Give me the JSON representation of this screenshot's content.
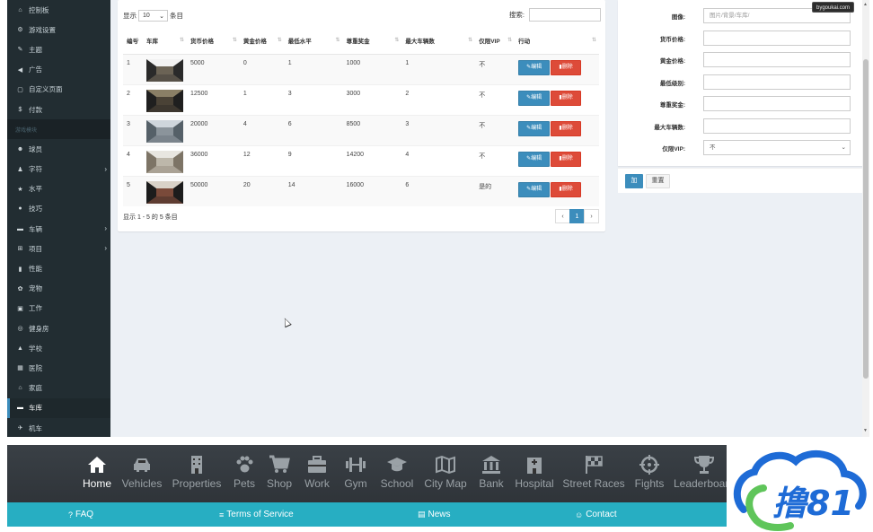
{
  "sidebar": {
    "items": [
      {
        "label": "控制板",
        "icon": "home-icon",
        "glyph": "⌂",
        "header": false,
        "arrow": false
      },
      {
        "label": "游戏设置",
        "icon": "gears-icon",
        "glyph": "⚙",
        "header": false,
        "arrow": false
      },
      {
        "label": "主题",
        "icon": "brush-icon",
        "glyph": "✎",
        "header": false,
        "arrow": false
      },
      {
        "label": "广告",
        "icon": "megaphone-icon",
        "glyph": "◀",
        "header": false,
        "arrow": false
      },
      {
        "label": "自定义页面",
        "icon": "window-icon",
        "glyph": "▢",
        "header": false,
        "arrow": false
      },
      {
        "label": "付款",
        "icon": "dollar-icon",
        "glyph": "$",
        "header": false,
        "arrow": false
      },
      {
        "label": "游戏模块",
        "icon": "",
        "glyph": "",
        "header": true,
        "arrow": false
      },
      {
        "label": "球员",
        "icon": "users-icon",
        "glyph": "☻",
        "header": false,
        "arrow": false
      },
      {
        "label": "字符",
        "icon": "person-icon",
        "glyph": "♟",
        "header": false,
        "arrow": true
      },
      {
        "label": "水平",
        "icon": "star-icon",
        "glyph": "★",
        "header": false,
        "arrow": false
      },
      {
        "label": "技巧",
        "icon": "lightbulb-icon",
        "glyph": "●",
        "header": false,
        "arrow": false
      },
      {
        "label": "车辆",
        "icon": "car-icon",
        "glyph": "▬",
        "header": false,
        "arrow": true
      },
      {
        "label": "项目",
        "icon": "cart-icon",
        "glyph": "⊞",
        "header": false,
        "arrow": true
      },
      {
        "label": "性能",
        "icon": "building-icon",
        "glyph": "▮",
        "header": false,
        "arrow": false
      },
      {
        "label": "宠物",
        "icon": "paw-icon",
        "glyph": "✿",
        "header": false,
        "arrow": false
      },
      {
        "label": "工作",
        "icon": "briefcase-icon",
        "glyph": "▣",
        "header": false,
        "arrow": false
      },
      {
        "label": "健身房",
        "icon": "target-icon",
        "glyph": "◎",
        "header": false,
        "arrow": false
      },
      {
        "label": "学校",
        "icon": "graduation-cap-icon",
        "glyph": "▲",
        "header": false,
        "arrow": false
      },
      {
        "label": "医院",
        "icon": "hospital-icon",
        "glyph": "▦",
        "header": false,
        "arrow": false
      },
      {
        "label": "家庭",
        "icon": "home-icon",
        "glyph": "⌂",
        "header": false,
        "arrow": false
      },
      {
        "label": "车库",
        "icon": "car-icon",
        "glyph": "▬",
        "header": false,
        "arrow": false,
        "active": true
      },
      {
        "label": "机车",
        "icon": "plane-icon",
        "glyph": "✈",
        "header": false,
        "arrow": false
      }
    ]
  },
  "table": {
    "length_prefix": "显示",
    "length_value": "10",
    "length_suffix": "条目",
    "search_label": "搜索:",
    "columns": [
      "编号",
      "车库",
      "货币价格",
      "黄金价格",
      "最低水平",
      "尊重奖金",
      "最大车辆数",
      "仅限VIP",
      "行动"
    ],
    "rows": [
      {
        "id": "1",
        "money": "5000",
        "gold": "0",
        "level": "1",
        "respect": "1000",
        "max": "1",
        "vip": "不",
        "thumb": "garage-1"
      },
      {
        "id": "2",
        "money": "12500",
        "gold": "1",
        "level": "3",
        "respect": "3000",
        "max": "2",
        "vip": "不",
        "thumb": "garage-2"
      },
      {
        "id": "3",
        "money": "20000",
        "gold": "4",
        "level": "6",
        "respect": "8500",
        "max": "3",
        "vip": "不",
        "thumb": "garage-3"
      },
      {
        "id": "4",
        "money": "36000",
        "gold": "12",
        "level": "9",
        "respect": "14200",
        "max": "4",
        "vip": "不",
        "thumb": "garage-4"
      },
      {
        "id": "5",
        "money": "50000",
        "gold": "20",
        "level": "14",
        "respect": "16000",
        "max": "6",
        "vip": "是的",
        "thumb": "garage-5"
      }
    ],
    "edit_label": "编辑",
    "delete_label": "删除",
    "info": "显示 1 - 5 的 5 条目",
    "pager_prev": "‹",
    "pager_page": "1",
    "pager_next": "›"
  },
  "form": {
    "fields": [
      {
        "label": "图像:",
        "placeholder": "图片/背景/车库/",
        "type": "input"
      },
      {
        "label": "货币价格:",
        "placeholder": "",
        "type": "input"
      },
      {
        "label": "黄金价格:",
        "placeholder": "",
        "type": "input"
      },
      {
        "label": "最低级别:",
        "placeholder": "",
        "type": "input"
      },
      {
        "label": "尊重奖金:",
        "placeholder": "",
        "type": "input"
      },
      {
        "label": "最大车辆数:",
        "placeholder": "",
        "type": "input"
      },
      {
        "label": "仅限VIP:",
        "placeholder": "不",
        "type": "select"
      }
    ],
    "add_label": "加",
    "reset_label": "重置"
  },
  "watermark": "bygoukai.com",
  "gamenav": {
    "items": [
      "Home",
      "Vehicles",
      "Properties",
      "Pets",
      "Shop",
      "Work",
      "Gym",
      "School",
      "City Map",
      "Bank",
      "Hospital",
      "Street Races",
      "Fights",
      "Leaderboard"
    ],
    "icons": [
      "home-icon",
      "car-icon",
      "building-icon",
      "paw-icon",
      "cart-icon",
      "briefcase-icon",
      "dumbbell-icon",
      "graduation-cap-icon",
      "map-icon",
      "bank-icon",
      "hospital-icon",
      "checkered-flag-icon",
      "crosshair-icon",
      "trophy-icon"
    ],
    "active": "Home"
  },
  "footer": {
    "items": [
      {
        "label": "FAQ",
        "icon": "question-circle-icon"
      },
      {
        "label": "Terms of Service",
        "icon": "list-icon"
      },
      {
        "label": "News",
        "icon": "newspaper-icon"
      },
      {
        "label": "Contact",
        "icon": "contact-icon"
      }
    ]
  },
  "logo": {
    "text": "撸81",
    "colors": {
      "blue": "#1e6bd6",
      "green": "#5fc55a"
    }
  },
  "colors": {
    "sidebar": "#222d32",
    "primary": "#3c8dbc",
    "danger": "#dd4b39",
    "footer": "#27aec2"
  }
}
